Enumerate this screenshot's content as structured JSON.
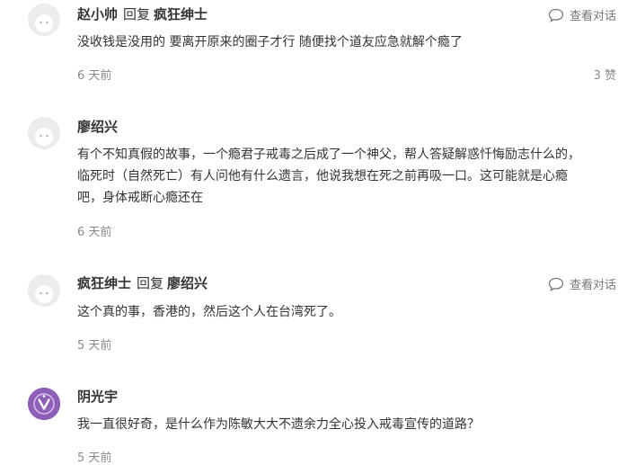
{
  "comments": [
    {
      "author": "赵小帅",
      "reply_word": "回复",
      "reply_to": "疯狂绅士",
      "text_lines": [
        "没收钱是没用的 要离开原来的圈子才行 随便找个道友应急就解个瘾了"
      ],
      "time": "6 天前",
      "likes": "3 赞",
      "view_conversation": "查看对话",
      "avatar_icon": "default-avatar-icon"
    },
    {
      "author": "廖绍兴",
      "text_lines": [
        "有个不知真假的故事，一个瘾君子戒毒之后成了一个神父，帮人答疑解惑忏悔励志什么的，",
        "临死时（自然死亡）有人问他有什么遗言，他说我想在死之前再吸一口。这可能就是心瘾",
        "吧，身体戒断心瘾还在"
      ],
      "time": "6 天前",
      "avatar_icon": "default-avatar-icon"
    },
    {
      "author": "疯狂绅士",
      "reply_word": "回复",
      "reply_to": "廖绍兴",
      "text_lines": [
        "这个真的事，香港的，然后这个人在台湾死了。"
      ],
      "time": "5 天前",
      "view_conversation": "查看对话",
      "avatar_icon": "default-avatar-icon"
    },
    {
      "author": "阴光宇",
      "text_lines": [
        "我一直很好奇，是什么作为陈敏大大不遗余力全心投入戒毒宣传的道路？"
      ],
      "time": "5 天前",
      "avatar_icon": "purple-badge-avatar-icon"
    }
  ],
  "colors": {
    "text": "#333333",
    "muted": "#8a8a8a",
    "avatar_bg": "#e9e9e9",
    "avatar_purple": "#8e5fb7"
  }
}
